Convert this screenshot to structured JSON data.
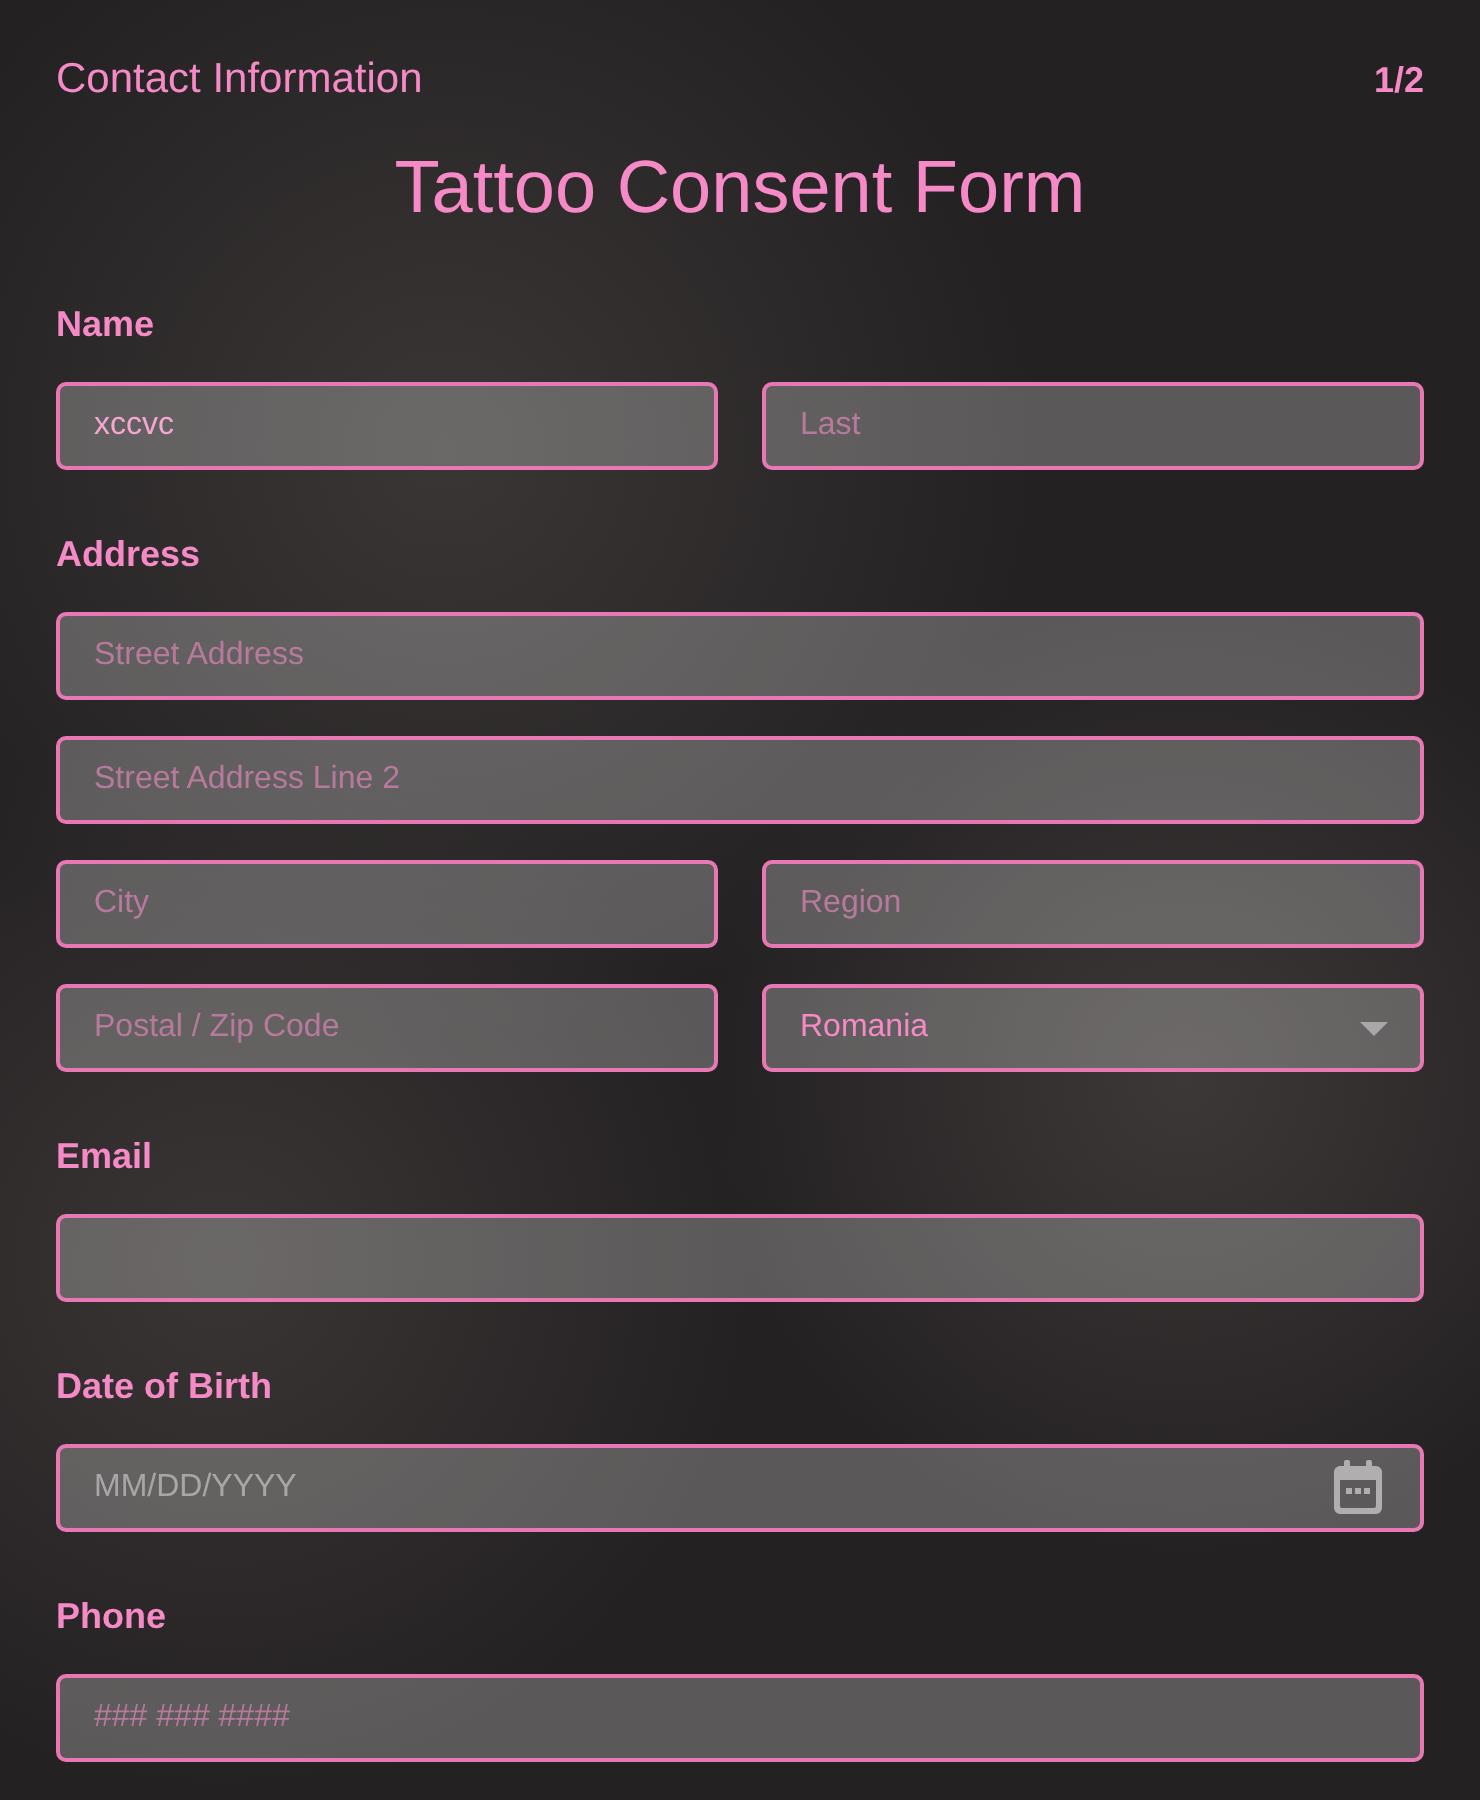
{
  "header": {
    "section": "Contact Information",
    "page": "1/2"
  },
  "title": "Tattoo Consent Form",
  "sections": [
    {
      "label": "Name",
      "rows": [
        [
          {
            "kind": "text",
            "value": "xccvc"
          },
          {
            "kind": "text",
            "placeholder": "Last"
          }
        ]
      ]
    },
    {
      "label": "Address",
      "rows": [
        [
          {
            "kind": "text",
            "placeholder": "Street Address"
          }
        ],
        [
          {
            "kind": "text",
            "placeholder": "Street Address Line 2"
          }
        ],
        [
          {
            "kind": "text",
            "placeholder": "City"
          },
          {
            "kind": "text",
            "placeholder": "Region"
          }
        ],
        [
          {
            "kind": "text",
            "placeholder": "Postal / Zip Code"
          },
          {
            "kind": "select",
            "value": "Romania"
          }
        ]
      ]
    },
    {
      "label": "Email",
      "rows": [
        [
          {
            "kind": "text"
          }
        ]
      ]
    },
    {
      "label": "Date of Birth",
      "rows": [
        [
          {
            "kind": "date",
            "placeholder": "MM/DD/YYYY"
          }
        ]
      ]
    },
    {
      "label": "Phone",
      "rows": [
        [
          {
            "kind": "text",
            "placeholder": "### ### ####"
          }
        ]
      ]
    }
  ]
}
